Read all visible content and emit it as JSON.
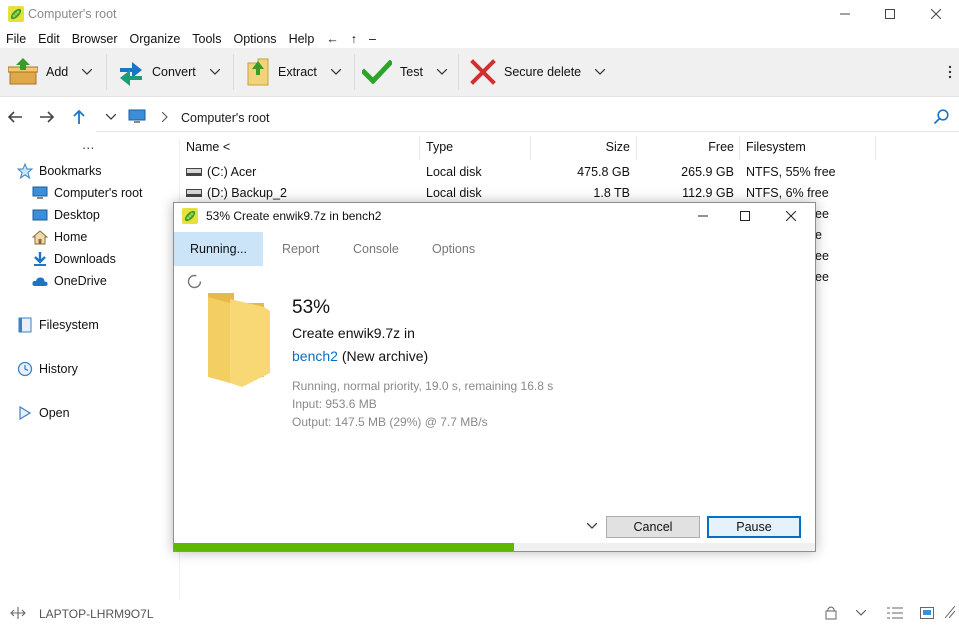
{
  "window": {
    "title": "Computer's root"
  },
  "menu": [
    "File",
    "Edit",
    "Browser",
    "Organize",
    "Tools",
    "Options",
    "Help",
    "←",
    "↑",
    "–"
  ],
  "toolbar": {
    "add": "Add",
    "convert": "Convert",
    "extract": "Extract",
    "test": "Test",
    "secure_delete": "Secure delete"
  },
  "address": {
    "path": "Computer's root"
  },
  "sidebar": {
    "more": "⋯",
    "bookmarks": "Bookmarks",
    "items": [
      "Computer's root",
      "Desktop",
      "Home",
      "Downloads",
      "OneDrive"
    ],
    "filesystem": "Filesystem",
    "history": "History",
    "open": "Open"
  },
  "columns": {
    "name": "Name <",
    "type": "Type",
    "size": "Size",
    "free": "Free",
    "filesystem": "Filesystem"
  },
  "rows": [
    {
      "name": "(C:) Acer",
      "type": "Local disk",
      "size": "475.8 GB",
      "free": "265.9 GB",
      "fs": "NTFS, 55% free"
    },
    {
      "name": "(D:) Backup_2",
      "type": "Local disk",
      "size": "1.8 TB",
      "free": "112.9 GB",
      "fs": "NTFS, 6% free"
    }
  ],
  "hidden_fragments": [
    "ee",
    "e",
    "ee",
    "ee"
  ],
  "dialog": {
    "title": "53% Create enwik9.7z in bench2",
    "tabs": [
      "Running...",
      "Report",
      "Console",
      "Options"
    ],
    "percent": "53%",
    "line1": "Create enwik9.7z in",
    "link": "bench2",
    "link_suffix": " (New archive)",
    "status": "Running, normal priority, 19.0 s, remaining 16.8 s",
    "input": "Input: 953.6 MB",
    "output": "Output: 147.5 MB (29%) @ 7.7 MB/s",
    "cancel": "Cancel",
    "pause": "Pause",
    "progress": 0.53
  },
  "status": {
    "host": "LAPTOP-LHRM9O7L"
  },
  "colors": {
    "accent": "#0a6fc2",
    "progress": "#5cb800",
    "tab_active": "#cce4f7"
  }
}
